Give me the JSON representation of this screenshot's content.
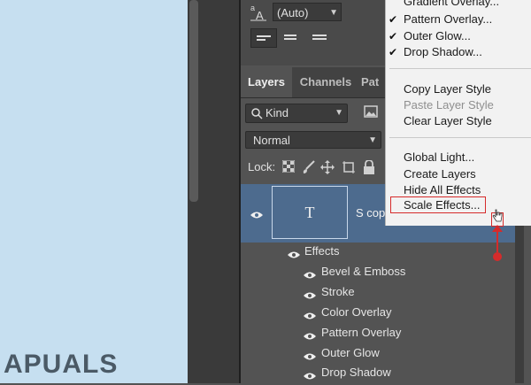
{
  "text_options": {
    "aa_value": "(Auto)"
  },
  "tabs": [
    {
      "label": "Layers"
    },
    {
      "label": "Channels"
    },
    {
      "label": "Pat"
    }
  ],
  "filter": {
    "kind_label": "Kind"
  },
  "blend": {
    "mode": "Normal"
  },
  "lock": {
    "label": "Lock:"
  },
  "layer": {
    "thumb_letter": "T",
    "name": "S copy"
  },
  "effects": {
    "header": "Effects",
    "items": [
      "Bevel & Emboss",
      "Stroke",
      "Color Overlay",
      "Pattern Overlay",
      "Outer Glow",
      "Drop Shadow"
    ]
  },
  "context_menu": {
    "group1": [
      {
        "label": "Gradient Overlay...",
        "checked": false
      },
      {
        "label": "Pattern Overlay...",
        "checked": true
      },
      {
        "label": "Outer Glow...",
        "checked": true
      },
      {
        "label": "Drop Shadow...",
        "checked": true
      }
    ],
    "group2": [
      {
        "label": "Copy Layer Style",
        "disabled": false
      },
      {
        "label": "Paste Layer Style",
        "disabled": true
      },
      {
        "label": "Clear Layer Style",
        "disabled": false
      }
    ],
    "group3": [
      {
        "label": "Global Light..."
      },
      {
        "label": "Create Layers"
      },
      {
        "label": "Hide All Effects"
      },
      {
        "label": "Scale Effects..."
      }
    ]
  },
  "annotation": {
    "color": "#d62b2b"
  },
  "watermark": {
    "text": "APUALS"
  },
  "colors": {
    "selected_layer": "#4d6b8e",
    "panel": "#535353",
    "menu_bg": "#f2f2f2"
  }
}
